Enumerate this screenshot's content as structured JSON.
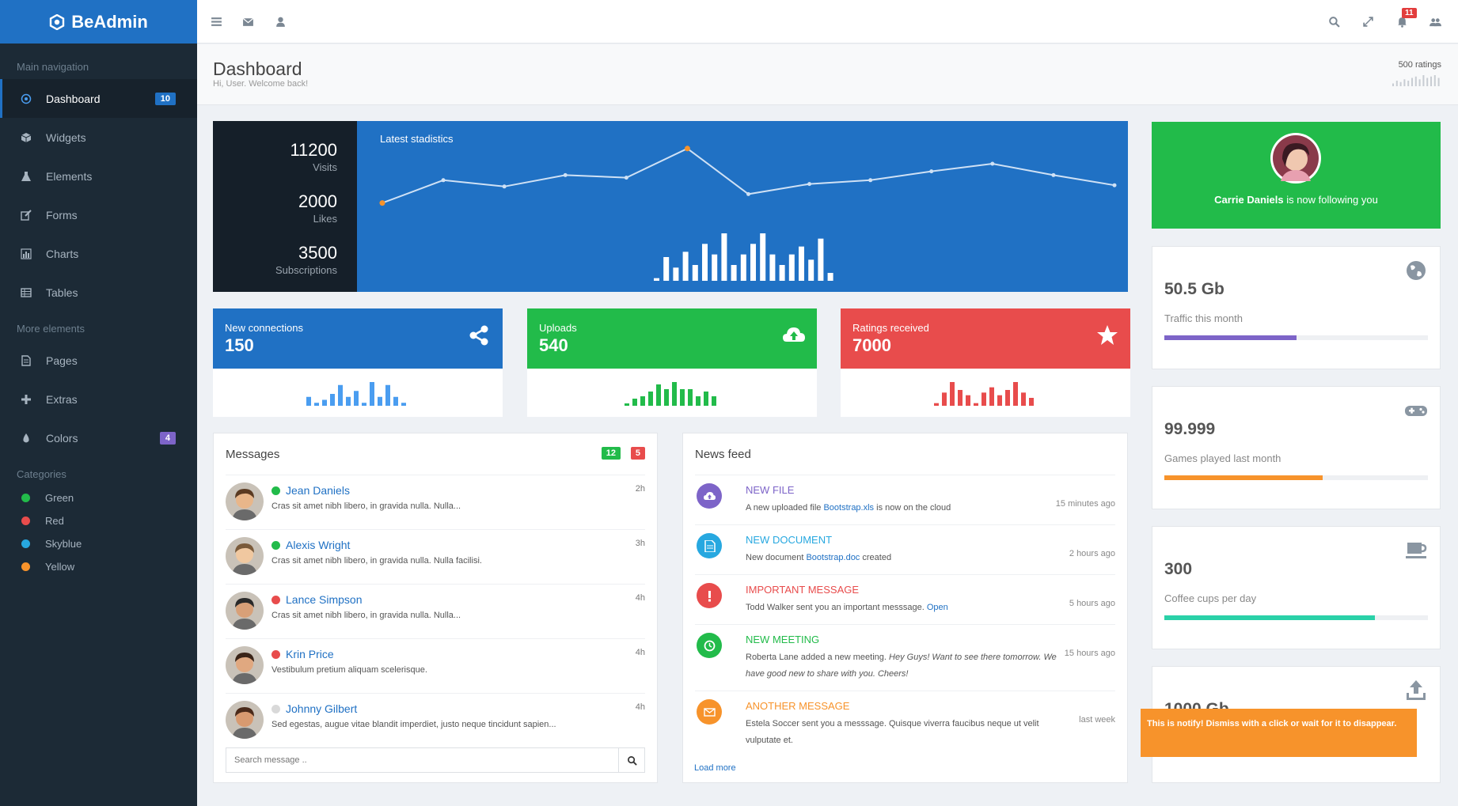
{
  "brand": {
    "name": "BeAdmin"
  },
  "sidebar": {
    "main_heading": "Main navigation",
    "main_items": [
      {
        "label": "Dashboard",
        "icon": "dashboard-icon",
        "badge": "10",
        "badge_color": "#2071c4",
        "active": true
      },
      {
        "label": "Widgets",
        "icon": "cube-icon"
      },
      {
        "label": "Elements",
        "icon": "flask-icon"
      },
      {
        "label": "Forms",
        "icon": "edit-icon"
      },
      {
        "label": "Charts",
        "icon": "bar-chart-icon"
      },
      {
        "label": "Tables",
        "icon": "table-icon"
      }
    ],
    "more_heading": "More elements",
    "more_items": [
      {
        "label": "Pages",
        "icon": "file-icon"
      },
      {
        "label": "Extras",
        "icon": "plus-icon"
      },
      {
        "label": "Colors",
        "icon": "tint-icon",
        "badge": "4",
        "badge_color": "#7d64c8"
      }
    ],
    "categories_heading": "Categories",
    "categories": [
      {
        "label": "Green",
        "color": "#22bb4a"
      },
      {
        "label": "Red",
        "color": "#e84c4c"
      },
      {
        "label": "Skyblue",
        "color": "#27a8e0"
      },
      {
        "label": "Yellow",
        "color": "#f7932b"
      }
    ]
  },
  "topbar": {
    "notifications_count": "11"
  },
  "page": {
    "title": "Dashboard",
    "subtitle": "Hi, User. Welcome back!",
    "ratings_label": "500 ratings",
    "ratings_bars": [
      2,
      4,
      3,
      5,
      4,
      6,
      7,
      5,
      8,
      6,
      7,
      8,
      6
    ]
  },
  "stats": {
    "title": "Latest stadistics",
    "items": [
      {
        "value": "11200",
        "label": "Visits"
      },
      {
        "value": "2000",
        "label": "Likes"
      },
      {
        "value": "3500",
        "label": "Subscriptions"
      }
    ],
    "line": [
      0.46,
      0.28,
      0.33,
      0.24,
      0.26,
      0.03,
      0.39,
      0.31,
      0.28,
      0.21,
      0.15,
      0.24,
      0.32
    ],
    "bars": [
      1,
      9,
      5,
      11,
      6,
      14,
      10,
      18,
      6,
      10,
      14,
      18,
      10,
      6,
      10,
      13,
      8,
      16,
      3
    ]
  },
  "tiles": [
    {
      "label": "New connections",
      "value": "150",
      "color": "#2071c4",
      "icon": "share-icon",
      "bar_color": "#4a9df0",
      "bars": [
        3,
        1,
        2,
        4,
        7,
        3,
        5,
        1,
        8,
        3,
        7,
        3,
        1
      ]
    },
    {
      "label": "Uploads",
      "value": "540",
      "color": "#22bb4a",
      "icon": "cloud-upload-icon",
      "bar_color": "#22bb4a",
      "bars": [
        1,
        3,
        4,
        6,
        9,
        7,
        10,
        7,
        7,
        4,
        6,
        4
      ]
    },
    {
      "label": "Ratings received",
      "value": "7000",
      "color": "#e84c4c",
      "icon": "star-icon",
      "bar_color": "#e84c4c",
      "bars": [
        1,
        5,
        9,
        6,
        4,
        1,
        5,
        7,
        4,
        6,
        9,
        5,
        3
      ]
    }
  ],
  "messages": {
    "title": "Messages",
    "badge_green": "12",
    "badge_red": "5",
    "items": [
      {
        "name": "Jean Daniels",
        "status": "#22bb4a",
        "text": "Cras sit amet nibh libero, in gravida nulla. Nulla...",
        "time": "2h",
        "skin": "#e8b68a",
        "hair": "#5a3a22"
      },
      {
        "name": "Alexis Wright",
        "status": "#22bb4a",
        "text": "Cras sit amet nibh libero, in gravida nulla. Nulla facilisi.",
        "time": "3h",
        "skin": "#f0c8a0",
        "hair": "#7a5a3a"
      },
      {
        "name": "Lance Simpson",
        "status": "#e84c4c",
        "text": "Cras sit amet nibh libero, in gravida nulla. Nulla...",
        "time": "4h",
        "skin": "#d8a078",
        "hair": "#2a2a2a"
      },
      {
        "name": "Krin Price",
        "status": "#e84c4c",
        "text": "Vestibulum pretium aliquam scelerisque.",
        "time": "4h",
        "skin": "#e0a880",
        "hair": "#3a2418"
      },
      {
        "name": "Johnny Gilbert",
        "status": "#d9d9d9",
        "text": "Sed egestas, augue vitae blandit imperdiet, justo neque tincidunt sapien...",
        "time": "4h",
        "skin": "#d89a70",
        "hair": "#4a2a1a"
      }
    ],
    "search_placeholder": "Search message .."
  },
  "newsfeed": {
    "title": "News feed",
    "items": [
      {
        "title": "NEW FILE",
        "color": "#7d64c8",
        "icon": "upload-icon",
        "pre": "A new uploaded file ",
        "link": "Bootstrap.xls",
        "post": " is now on the cloud",
        "em": "",
        "time": "15 minutes ago"
      },
      {
        "title": "NEW DOCUMENT",
        "color": "#27a8e0",
        "icon": "document-icon",
        "pre": "New document ",
        "link": "Bootstrap.doc",
        "post": " created",
        "em": "",
        "time": "2 hours ago"
      },
      {
        "title": "IMPORTANT MESSAGE",
        "color": "#e84c4c",
        "icon": "exclamation-icon",
        "pre": "Todd Walker sent you an important messsage. ",
        "link": "Open",
        "post": "",
        "em": "",
        "time": "5 hours ago"
      },
      {
        "title": "NEW MEETING",
        "color": "#22bb4a",
        "icon": "clock-icon",
        "pre": "Roberta Lane added a new meeting. ",
        "link": "",
        "post": "",
        "em": "Hey Guys! Want to see there tomorrow. We have good new to share with you. Cheers!",
        "time": "15 hours ago"
      },
      {
        "title": "ANOTHER MESSAGE",
        "color": "#f7932b",
        "icon": "envelope-icon",
        "pre": "Estela Soccer sent you a messsage. Quisque viverra faucibus neque ut velit vulputate et.",
        "link": "",
        "post": "",
        "em": "",
        "time": "last week"
      }
    ],
    "load_more": "Load more"
  },
  "follow": {
    "name": "Carrie Daniels",
    "text": " is now following you",
    "color": "#22bb4a"
  },
  "cards": [
    {
      "value": "50.5 Gb",
      "label": "Traffic this month",
      "progress": 0.5,
      "color": "#7d64c8",
      "icon": "globe-icon"
    },
    {
      "value": "99.999",
      "label": "Games played last month",
      "progress": 0.6,
      "color": "#f7932b",
      "icon": "gamepad-icon"
    },
    {
      "value": "300",
      "label": "Coffee cups per day",
      "progress": 0.8,
      "color": "#2ad1a8",
      "icon": "coffee-icon"
    },
    {
      "value": "1000 Gb",
      "label": "",
      "progress": 0,
      "color": "#2071c4",
      "icon": "upload-tray-icon"
    }
  ],
  "toast": {
    "text": "This is notify! Dismiss with a click or wait for it to disappear."
  }
}
